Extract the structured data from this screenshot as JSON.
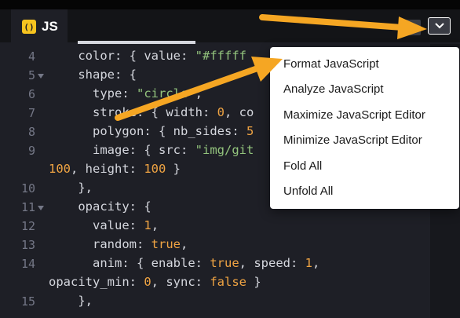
{
  "tab": {
    "icon": "js-braces-icon",
    "label": "JS"
  },
  "colors": {
    "accent": "#f7c41f",
    "annotation_arrow": "#f5a623",
    "string": "#93c47d",
    "number": "#f0a443"
  },
  "code": {
    "line4": {
      "n": "4",
      "prop": "color",
      "p1": ": { ",
      "k": "value",
      "p2": ": ",
      "v": "\"#fffff"
    },
    "line5": {
      "n": "5",
      "prop": "shape",
      "p1": ": {"
    },
    "line6": {
      "n": "6",
      "prop": "type",
      "p1": ": ",
      "v": "\"circle\"",
      "p2": ","
    },
    "line7": {
      "n": "7",
      "prop": "stroke",
      "p1": ": { ",
      "k": "width",
      "p2": ": ",
      "v": "0",
      "p3": ", co"
    },
    "line8": {
      "n": "8",
      "prop": "polygon",
      "p1": ": { ",
      "k": "nb_sides",
      "p2": ": ",
      "v": "5"
    },
    "line9": {
      "n": "9",
      "prop": "image",
      "p1": ": { ",
      "k": "src",
      "p2": ": ",
      "v": "\"img/git"
    },
    "line9b": {
      "v1": "100",
      "p1": ", ",
      "k": "height",
      "p2": ": ",
      "v2": "100",
      "p3": " }"
    },
    "line10": {
      "n": "10",
      "text": "},",
      "indent": "    "
    },
    "line11": {
      "n": "11",
      "prop": "opacity",
      "p1": ": {"
    },
    "line12": {
      "n": "12",
      "prop": "value",
      "p1": ": ",
      "v": "1",
      "p2": ","
    },
    "line13": {
      "n": "13",
      "prop": "random",
      "p1": ": ",
      "v": "true",
      "p2": ","
    },
    "line14": {
      "n": "14",
      "prop": "anim",
      "p1": ": { ",
      "k1": "enable",
      "p2": ": ",
      "v1": "true",
      "p3": ", ",
      "k2": "speed",
      "p4": ": ",
      "v2": "1",
      "p5": ","
    },
    "line14b": {
      "k1": "opacity_min",
      "p1": ": ",
      "v1": "0",
      "p2": ", ",
      "k2": "sync",
      "p3": ": ",
      "v2": "false",
      "p4": " }"
    },
    "line15": {
      "n": "15",
      "text": "},"
    }
  },
  "menu": {
    "items": [
      "Format JavaScript",
      "Analyze JavaScript",
      "Maximize JavaScript Editor",
      "Minimize JavaScript Editor",
      "Fold All",
      "Unfold All"
    ]
  }
}
